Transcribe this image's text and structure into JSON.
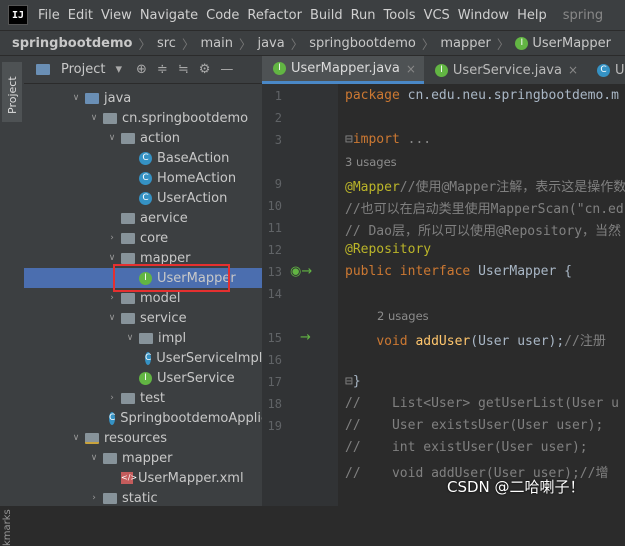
{
  "menubar": {
    "logo": "IJ",
    "items": [
      "File",
      "Edit",
      "View",
      "Navigate",
      "Code",
      "Refactor",
      "Build",
      "Run",
      "Tools",
      "VCS",
      "Window",
      "Help"
    ],
    "project_title": "spring"
  },
  "breadcrumb": [
    "springbootdemo",
    "src",
    "main",
    "java",
    "springbootdemo",
    "mapper",
    "UserMapper"
  ],
  "sidebar": {
    "project_tab": "Project",
    "bookmarks_tab": "kmarks"
  },
  "project_panel": {
    "title": "Project",
    "tools": [
      "globe-icon",
      "collapse-icon",
      "expand-icon",
      "gear-icon",
      "minimize-icon"
    ]
  },
  "tree": [
    {
      "label": "java",
      "indent": 0,
      "icon": "folder-blue",
      "arrow": "down"
    },
    {
      "label": "cn.springbootdemo",
      "indent": 1,
      "icon": "folder",
      "arrow": "down"
    },
    {
      "label": "action",
      "indent": 2,
      "icon": "folder",
      "arrow": "down"
    },
    {
      "label": "BaseAction",
      "indent": 3,
      "icon": "class",
      "arrow": ""
    },
    {
      "label": "HomeAction",
      "indent": 3,
      "icon": "class",
      "arrow": ""
    },
    {
      "label": "UserAction",
      "indent": 3,
      "icon": "class",
      "arrow": ""
    },
    {
      "label": "aervice",
      "indent": 2,
      "icon": "folder",
      "arrow": ""
    },
    {
      "label": "core",
      "indent": 2,
      "icon": "folder",
      "arrow": "right"
    },
    {
      "label": "mapper",
      "indent": 2,
      "icon": "folder",
      "arrow": "down"
    },
    {
      "label": "UserMapper",
      "indent": 3,
      "icon": "interface",
      "arrow": "",
      "selected": true
    },
    {
      "label": "model",
      "indent": 2,
      "icon": "folder",
      "arrow": "right"
    },
    {
      "label": "service",
      "indent": 2,
      "icon": "folder",
      "arrow": "down"
    },
    {
      "label": "impl",
      "indent": 3,
      "icon": "folder",
      "arrow": "down"
    },
    {
      "label": "UserServiceImpl",
      "indent": 4,
      "icon": "class",
      "arrow": ""
    },
    {
      "label": "UserService",
      "indent": 3,
      "icon": "interface",
      "arrow": ""
    },
    {
      "label": "test",
      "indent": 2,
      "icon": "folder",
      "arrow": "right"
    },
    {
      "label": "SpringbootdemoApplic",
      "indent": 2,
      "icon": "class",
      "arrow": ""
    },
    {
      "label": "resources",
      "indent": 0,
      "icon": "folder-res",
      "arrow": "down"
    },
    {
      "label": "mapper",
      "indent": 1,
      "icon": "folder",
      "arrow": "down"
    },
    {
      "label": "UserMapper.xml",
      "indent": 2,
      "icon": "xml",
      "arrow": ""
    },
    {
      "label": "static",
      "indent": 1,
      "icon": "folder",
      "arrow": "right"
    }
  ],
  "tabs": [
    {
      "label": "UserMapper.java",
      "active": true,
      "icon": "interface"
    },
    {
      "label": "UserService.java",
      "active": false,
      "icon": "interface"
    },
    {
      "label": "UserSe",
      "active": false,
      "icon": "class"
    }
  ],
  "editor": {
    "line_numbers": [
      "1",
      "2",
      "3",
      "",
      "9",
      "10",
      "11",
      "12",
      "",
      "13",
      "14",
      "15",
      "16",
      "17",
      "18",
      "19"
    ],
    "lines": [
      {
        "parts": [
          [
            "kw",
            "package "
          ],
          [
            "",
            "cn.edu.neu.springbootdemo.m"
          ]
        ]
      },
      {
        "parts": []
      },
      {
        "parts": [
          [
            "kw",
            "import "
          ],
          [
            "fold",
            "..."
          ]
        ],
        "fold": true
      },
      {
        "hint": "3 usages"
      },
      {
        "parts": [
          [
            "ann",
            "@Mapper"
          ],
          [
            "cmt",
            "//使用@Mapper注解，表示这是操作数"
          ]
        ]
      },
      {
        "parts": [
          [
            "cmt",
            "//也可以在启动类里使用MapperScan(\"cn.ed"
          ]
        ]
      },
      {
        "parts": [
          [
            "cmt",
            "// Dao层，所以可以使用@Repository，当然"
          ]
        ]
      },
      {
        "parts": [
          [
            "ann",
            "@Repository"
          ]
        ]
      },
      {
        "parts": [
          [
            "kw",
            "public interface "
          ],
          [
            "",
            "UserMapper {"
          ]
        ]
      },
      {
        "parts": []
      },
      {
        "hint": "2 usages"
      },
      {
        "parts": [
          [
            "",
            "    "
          ],
          [
            "kw",
            "void "
          ],
          [
            "meth",
            "addUser"
          ],
          [
            "",
            "(User user);"
          ],
          [
            "cmt",
            "//注册"
          ]
        ]
      },
      {
        "parts": []
      },
      {
        "parts": [
          [
            "",
            "}"
          ]
        ],
        "fold": true
      },
      {
        "parts": [
          [
            "cmt",
            "//    List<User> getUserList(User u"
          ]
        ]
      },
      {
        "parts": [
          [
            "cmt",
            "//    User existsUser(User user);"
          ]
        ]
      },
      {
        "parts": [
          [
            "cmt",
            "//    int existUser(User user);"
          ]
        ]
      },
      {
        "parts": [
          [
            "cmt",
            "//    void addUser(User user);//增"
          ]
        ]
      }
    ]
  },
  "watermark": "CSDN @二哈喇子！"
}
